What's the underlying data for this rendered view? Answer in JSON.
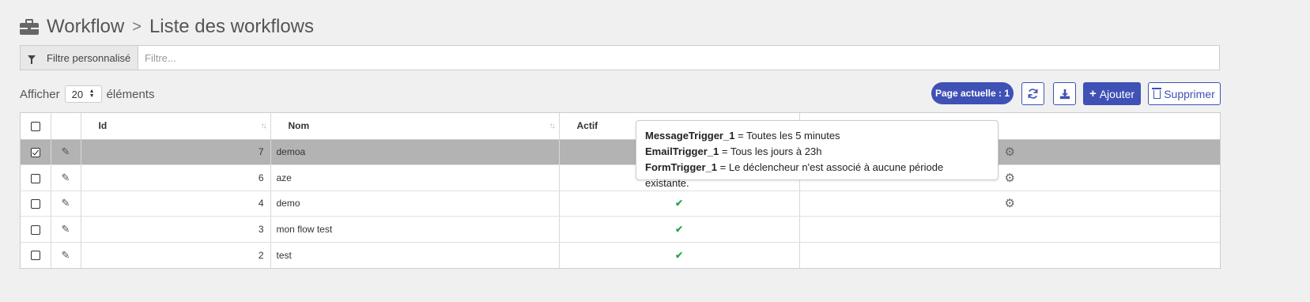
{
  "header": {
    "title": "Workflow",
    "separator": ">",
    "subtitle": "Liste des workflows",
    "icon": "briefcase-icon"
  },
  "filter": {
    "label": "Filtre personnalisé",
    "placeholder": "Filtre...",
    "value": "",
    "icon": "filter-icon"
  },
  "pagination": {
    "show_label": "Afficher",
    "page_size": "20",
    "items_label": "éléments"
  },
  "toolbar": {
    "page_badge": "Page actuelle : 1",
    "refresh_icon": "refresh-icon",
    "download_icon": "download-icon",
    "add_label": "Ajouter",
    "delete_label": "Supprimer"
  },
  "table": {
    "columns": [
      "Id",
      "Nom",
      "Actif"
    ],
    "rows": [
      {
        "id": "7",
        "nom": "demoa",
        "actif": false,
        "gear": true,
        "selected": true
      },
      {
        "id": "6",
        "nom": "aze",
        "actif": false,
        "gear": true,
        "selected": false
      },
      {
        "id": "4",
        "nom": "demo",
        "actif": true,
        "gear": true,
        "selected": false
      },
      {
        "id": "3",
        "nom": "mon flow test",
        "actif": true,
        "gear": false,
        "selected": false
      },
      {
        "id": "2",
        "nom": "test",
        "actif": true,
        "gear": false,
        "selected": false
      }
    ]
  },
  "tooltip": {
    "lines": [
      {
        "name": "MessageTrigger_1",
        "sep": " = ",
        "desc": "Toutes les 5 minutes"
      },
      {
        "name": "EmailTrigger_1",
        "sep": " = ",
        "desc": "Tous les jours à 23h"
      },
      {
        "name": "FormTrigger_1",
        "sep": " = ",
        "desc": "Le déclencheur n'est associé à aucune période existante."
      }
    ]
  },
  "colors": {
    "accent": "#3f51b5",
    "active_check": "#28a745",
    "selected_row": "#b3b3b3"
  }
}
